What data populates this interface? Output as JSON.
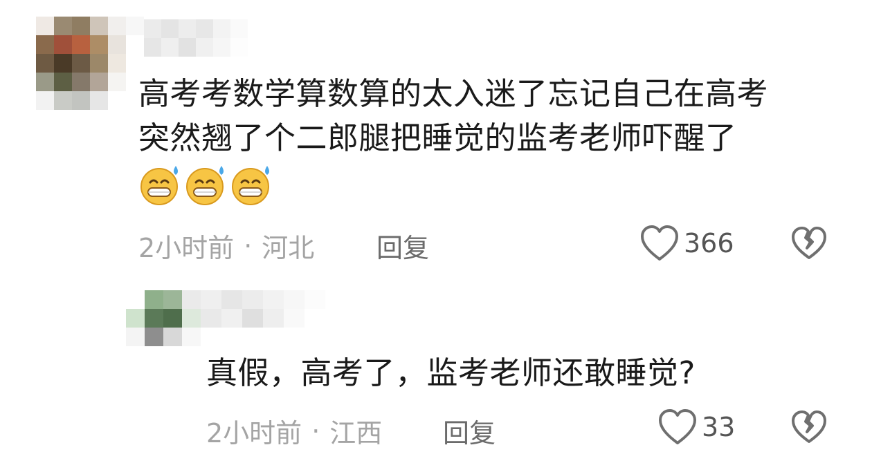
{
  "colors": {
    "text_primary": "#1a1a1a",
    "text_meta": "#a4a4a4",
    "reply": "#6b6b6b",
    "icon": "#6f6f6f"
  },
  "comments": [
    {
      "text_lines": [
        "高考考数学算数算的太入迷了忘记自己在高考",
        "突然翘了个二郎腿把睡觉的监考老师吓醒了"
      ],
      "emojis": [
        "grinning-sweat-emoji",
        "grinning-sweat-emoji",
        "grinning-sweat-emoji"
      ],
      "time": "2小时前",
      "separator": "·",
      "location": "河北",
      "reply_label": "回复",
      "like_count": "366",
      "like_icon": "heart-outline-icon",
      "dislike_icon": "broken-heart-icon"
    },
    {
      "text_lines": [
        "真假，高考了，监考老师还敢睡觉?"
      ],
      "time": "2小时前",
      "separator": "·",
      "location": "江西",
      "reply_label": "回复",
      "like_count": "33",
      "like_icon": "heart-outline-icon",
      "dislike_icon": "broken-heart-icon"
    }
  ]
}
